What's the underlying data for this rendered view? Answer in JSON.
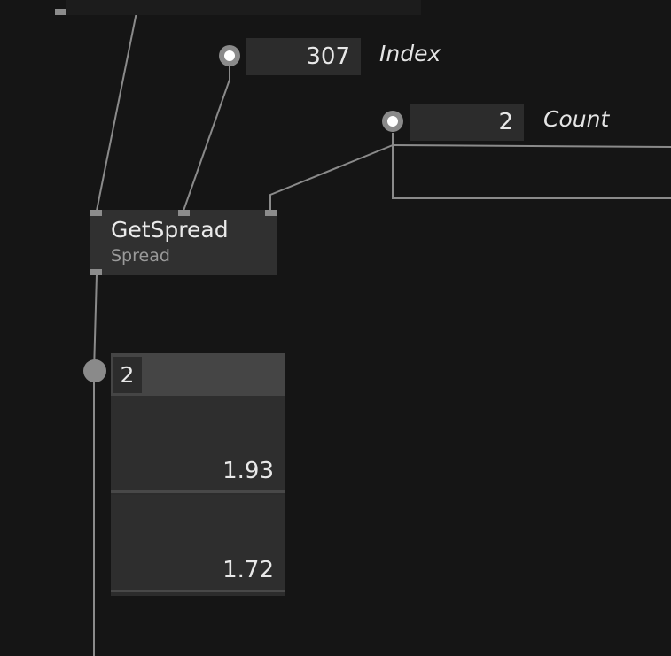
{
  "patch": {
    "index_box": {
      "value": "307",
      "label": "Index"
    },
    "count_box": {
      "value": "2",
      "label": "Count"
    },
    "node": {
      "title": "GetSpread",
      "category": "Spread"
    },
    "output_spread": {
      "count": "2",
      "slices": [
        "1.93",
        "1.72"
      ]
    }
  },
  "colors": {
    "background": "#151515",
    "node": "#303030",
    "iobox": "#2c2c2c",
    "wire": "#8a8a8a",
    "pin": "#8c8c8c"
  }
}
